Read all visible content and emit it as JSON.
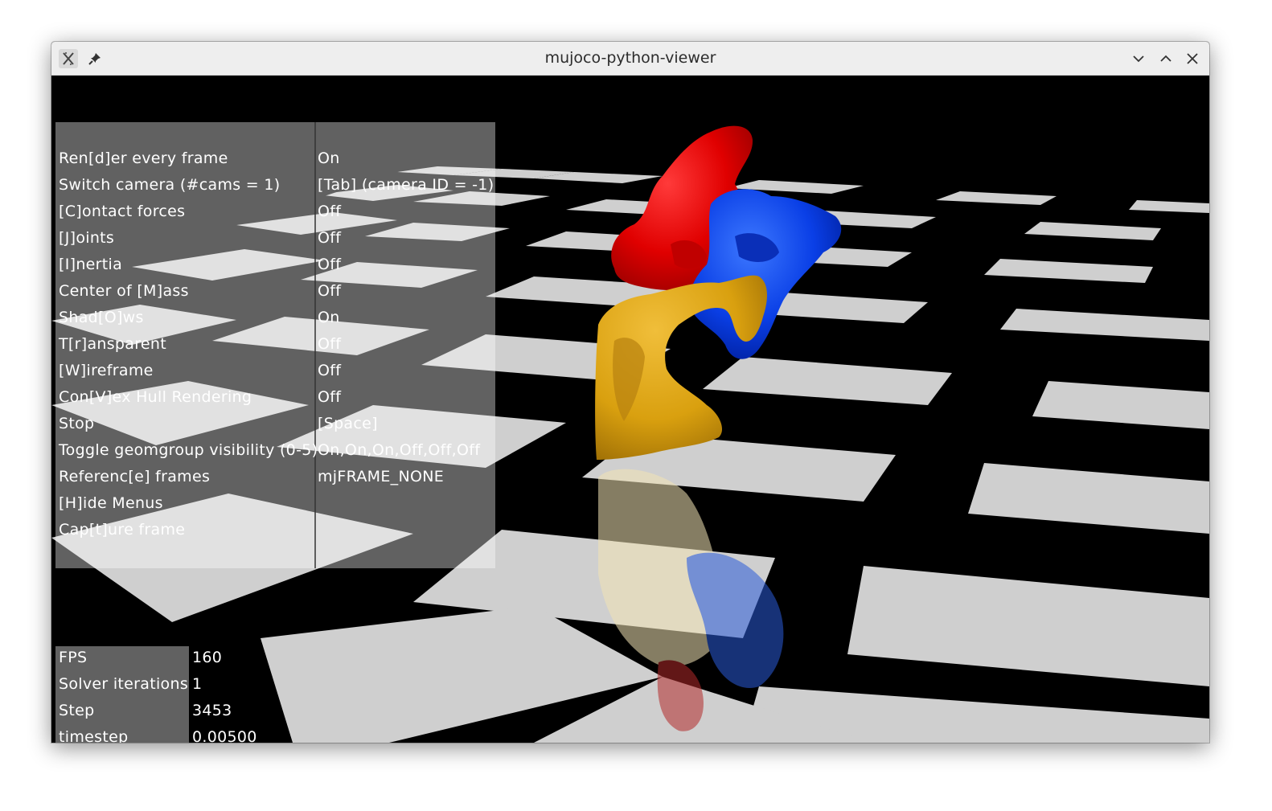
{
  "window": {
    "title": "mujoco-python-viewer"
  },
  "titlebar_icons": {
    "app": "x-app-icon",
    "pin": "pin-icon",
    "minimize": "chevron-down-icon",
    "maximize": "chevron-up-icon",
    "close": "close-icon"
  },
  "menu": [
    {
      "label": "Ren[d]er every frame",
      "value": "On"
    },
    {
      "label": "Switch camera (#cams = 1)",
      "value": "[Tab] (camera ID = -1)"
    },
    {
      "label": "[C]ontact forces",
      "value": "Off"
    },
    {
      "label": "[J]oints",
      "value": "Off"
    },
    {
      "label": "[I]nertia",
      "value": "Off"
    },
    {
      "label": "Center of [M]ass",
      "value": "Off"
    },
    {
      "label": "Shad[O]ws",
      "value": "On"
    },
    {
      "label": "T[r]ansparent",
      "value": "Off"
    },
    {
      "label": "[W]ireframe",
      "value": "Off"
    },
    {
      "label": "Con[V]ex Hull Rendering",
      "value": "Off"
    },
    {
      "label": "Stop",
      "value": "[Space]"
    },
    {
      "label": "Toggle geomgroup visibility (0-5)",
      "value": "On,On,On,Off,Off,Off"
    },
    {
      "label": "Referenc[e] frames",
      "value": "mjFRAME_NONE"
    },
    {
      "label": "[H]ide Menus",
      "value": ""
    },
    {
      "label": "Cap[t]ure frame",
      "value": ""
    }
  ],
  "info": [
    {
      "label": "FPS",
      "value": "160"
    },
    {
      "label": "Solver iterations",
      "value": "1"
    },
    {
      "label": "Step",
      "value": "3453"
    },
    {
      "label": "timestep",
      "value": "0.00500"
    }
  ],
  "scene": {
    "floor_light": "#d0d0d0",
    "floor_dark": "#000000",
    "object_colors": [
      "#e60000",
      "#0a3fe6",
      "#d9a00f"
    ]
  }
}
